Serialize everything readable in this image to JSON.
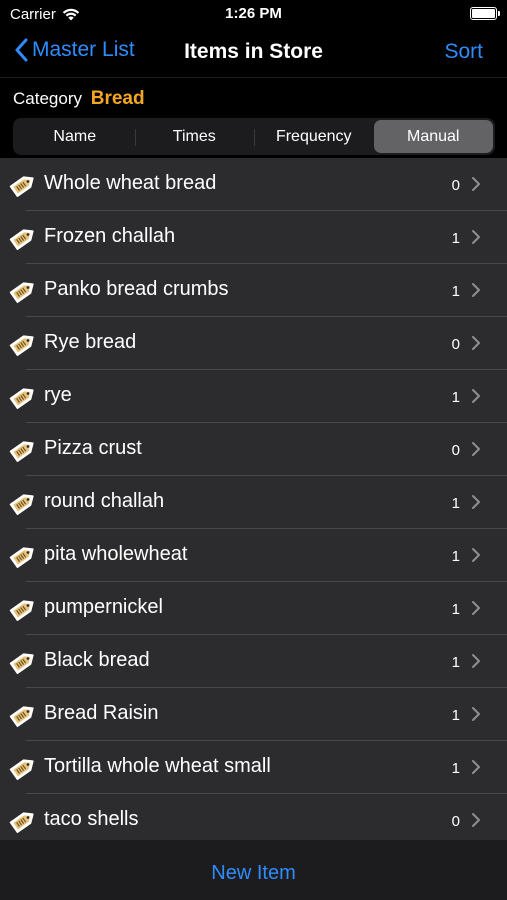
{
  "status": {
    "carrier": "Carrier",
    "time": "1:26 PM"
  },
  "nav": {
    "back_label": "Master List",
    "title": "Items in Store",
    "sort_label": "Sort"
  },
  "category": {
    "label": "Category",
    "value": "Bread"
  },
  "segments": [
    {
      "label": "Name"
    },
    {
      "label": "Times"
    },
    {
      "label": "Frequency"
    },
    {
      "label": "Manual"
    }
  ],
  "items": [
    {
      "name": "Whole wheat bread",
      "count": "0"
    },
    {
      "name": "Frozen challah",
      "count": "1"
    },
    {
      "name": "Panko bread crumbs",
      "count": "1"
    },
    {
      "name": "Rye bread",
      "count": "0"
    },
    {
      "name": "rye",
      "count": "1"
    },
    {
      "name": "Pizza crust",
      "count": "0"
    },
    {
      "name": "round challah",
      "count": "1"
    },
    {
      "name": "pita wholewheat",
      "count": "1"
    },
    {
      "name": "pumpernickel",
      "count": "1"
    },
    {
      "name": "Black bread",
      "count": "1"
    },
    {
      "name": "Bread Raisin",
      "count": "1"
    },
    {
      "name": "Tortilla whole wheat small",
      "count": "1"
    },
    {
      "name": "taco shells",
      "count": "0"
    }
  ],
  "toolbar": {
    "new_item_label": "New Item"
  },
  "colors": {
    "accent": "#2f8cff",
    "category": "#f5a623",
    "tag_icon": "#e8c27a"
  }
}
